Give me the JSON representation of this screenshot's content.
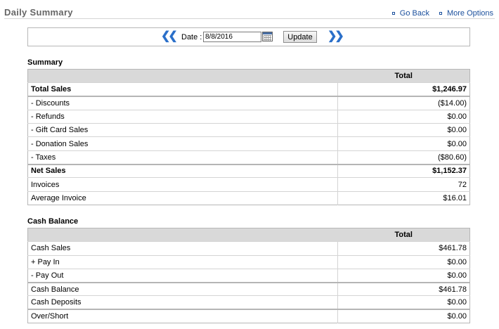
{
  "header": {
    "title": "Daily Summary",
    "go_back": "Go Back",
    "more_options": "More Options"
  },
  "date_bar": {
    "prev_icon": "double-chevron-left-icon",
    "next_icon": "double-chevron-right-icon",
    "date_label": "Date :",
    "date_value": "8/8/2016",
    "calendar_icon": "calendar-icon",
    "update_label": "Update"
  },
  "summary": {
    "title": "Summary",
    "column": "Total",
    "rows": [
      {
        "label": "Total Sales",
        "value": "$1,246.97"
      },
      {
        "label": "- Discounts",
        "value": "($14.00)"
      },
      {
        "label": "- Refunds",
        "value": "$0.00"
      },
      {
        "label": "- Gift Card Sales",
        "value": "$0.00"
      },
      {
        "label": "- Donation Sales",
        "value": "$0.00"
      },
      {
        "label": "- Taxes",
        "value": "($80.60)"
      },
      {
        "label": "Net Sales",
        "value": "$1,152.37"
      },
      {
        "label": "Invoices",
        "value": "72"
      },
      {
        "label": "Average Invoice",
        "value": "$16.01"
      }
    ]
  },
  "cash_balance": {
    "title": "Cash Balance",
    "column": "Total",
    "rows": [
      {
        "label": "Cash Sales",
        "value": "$461.78"
      },
      {
        "label": "+ Pay In",
        "value": "$0.00"
      },
      {
        "label": "- Pay Out",
        "value": "$0.00"
      },
      {
        "label": "Cash Balance",
        "value": "$461.78"
      },
      {
        "label": "Cash Deposits",
        "value": "$0.00"
      },
      {
        "label": "Over/Short",
        "value": "$0.00"
      }
    ]
  },
  "colors": {
    "link": "#1a4f9c",
    "arrow": "#2a6fc9",
    "header_bg": "#d9d9d9",
    "title_gray": "#666666"
  }
}
